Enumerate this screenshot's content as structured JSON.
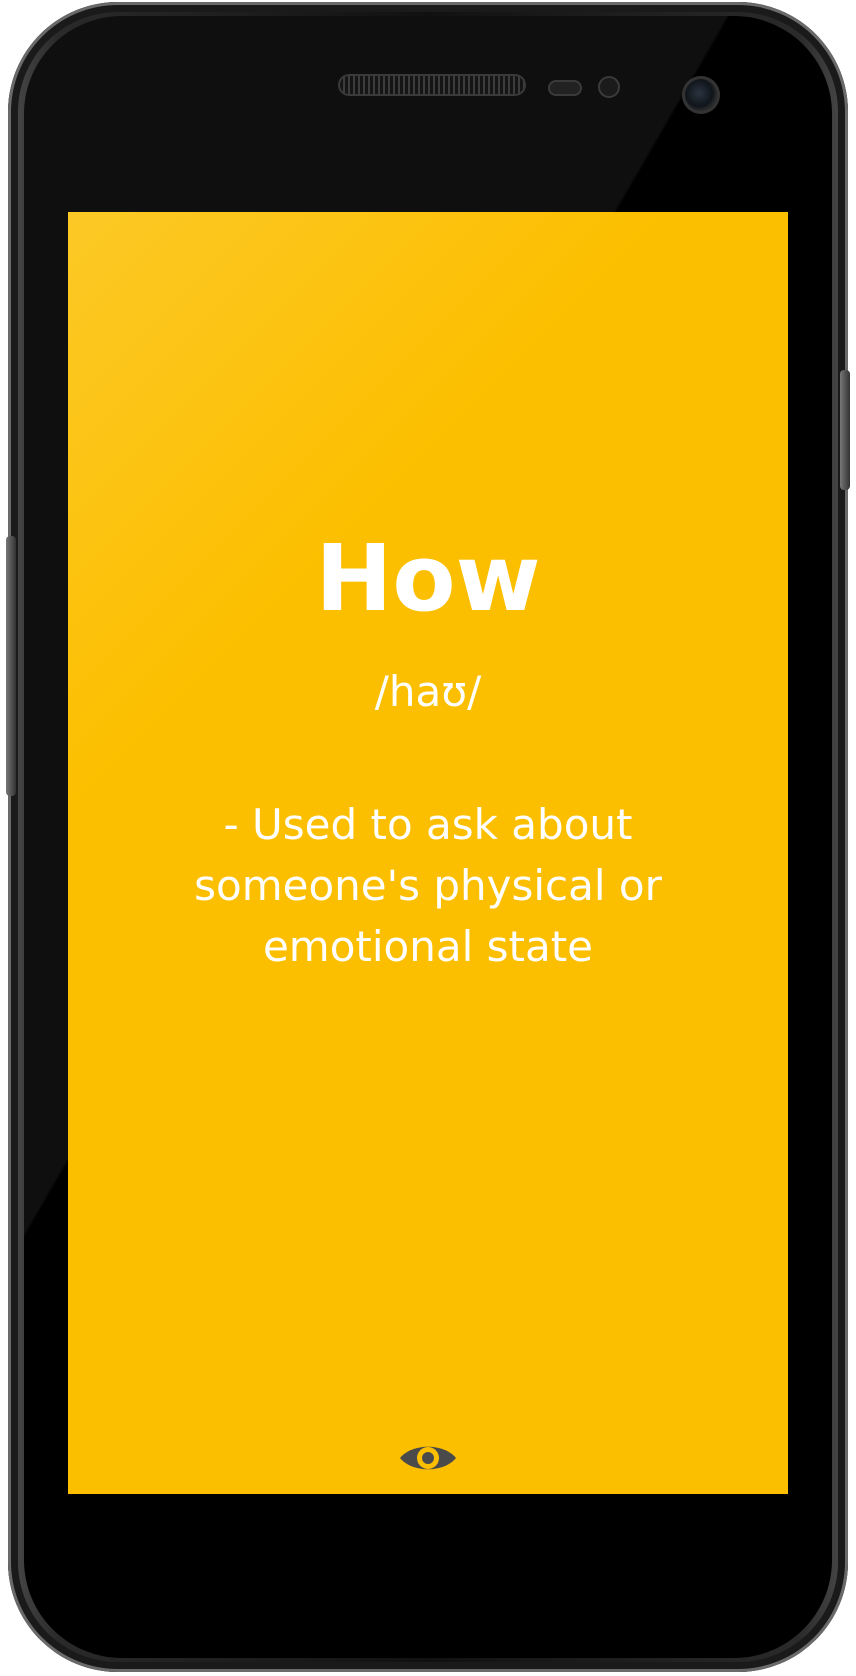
{
  "card": {
    "word": "How",
    "phonetic": "/haʊ/",
    "definition": "- Used to ask about someone's physical or emotional state"
  },
  "colors": {
    "card_background": "#fcbf00",
    "text": "#ffffff",
    "icon": "#4a4a4a"
  },
  "icons": {
    "reveal": "eye-icon"
  }
}
